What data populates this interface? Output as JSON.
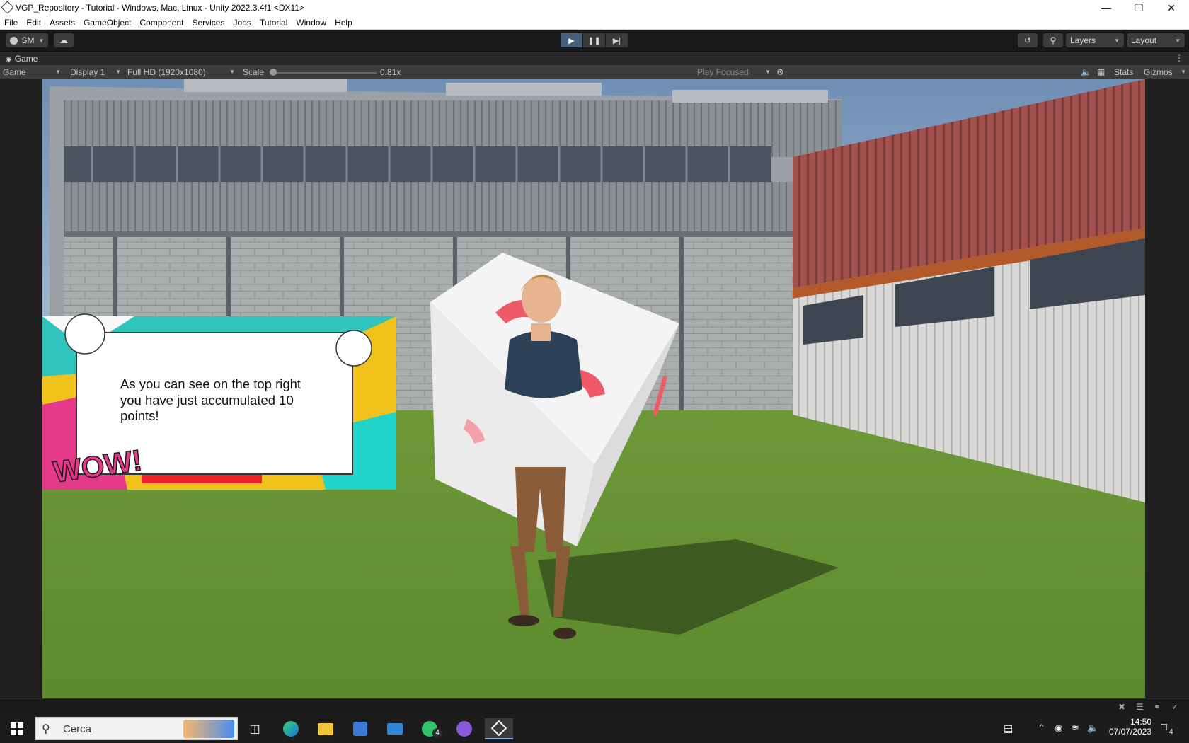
{
  "window": {
    "title": "VGP_Repository - Tutorial - Windows, Mac, Linux - Unity 2022.3.4f1 <DX11>",
    "minimize_icon": "minimize-icon",
    "restore_icon": "restore-icon",
    "close_icon": "close-icon"
  },
  "menu": [
    "File",
    "Edit",
    "Assets",
    "GameObject",
    "Component",
    "Services",
    "Jobs",
    "Tutorial",
    "Window",
    "Help"
  ],
  "toolbar": {
    "account_label": "SM",
    "layers_label": "Layers",
    "layout_label": "Layout",
    "accent": "#46607c"
  },
  "game_tab": {
    "tab_label": "Game",
    "view_select": "Game",
    "display_select": "Display 1",
    "resolution_select": "Full HD (1920x1080)",
    "scale_label": "Scale",
    "scale_value": "0.81x",
    "play_focus": "Play Focused",
    "stats_label": "Stats",
    "gizmos_label": "Gizmos"
  },
  "scene": {
    "dialog_text": "As you can see on the top right you have just accumulated 10 points!",
    "wow_text": "WOW!"
  },
  "taskbar": {
    "search_placeholder": "Cerca",
    "time": "14:50",
    "date": "07/07/2023",
    "whatsapp_badge": "4",
    "notification_badge": "4"
  }
}
